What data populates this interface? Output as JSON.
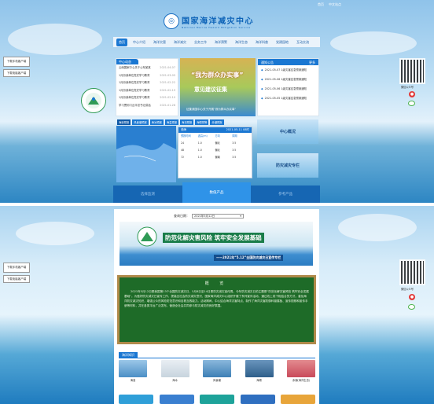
{
  "header": {
    "links": [
      "首页",
      "中文站点"
    ],
    "title": "国家海洋减灾中心",
    "subtitle": "National Marine Hazard Mitigation Service"
  },
  "nav": {
    "items": [
      "首页",
      "中心介绍",
      "海洋灾害",
      "海洋减灾",
      "业务工作",
      "海洋预警",
      "海洋生态",
      "海洋科普",
      "党建园地",
      "互动交流"
    ],
    "active_index": 0
  },
  "float": {
    "btn1": "下载手机客户端",
    "btn2": "下载电脑客户端"
  },
  "qr": {
    "caption": "微信公众号"
  },
  "news": {
    "header": "中心动态",
    "items": [
      {
        "text": "云南国家中心关于公布某某",
        "date": "2021-04-07"
      },
      {
        "text": "1月份我单位党史学习教育",
        "date": "2021-03-05"
      },
      {
        "text": "1月份我单位党史学习教育",
        "date": "2021-02-22"
      },
      {
        "text": "1月份我单位党史学习教育",
        "date": "2021-02-19"
      },
      {
        "text": "1月份我单位党史学习教育",
        "date": "2021-02-10"
      },
      {
        "text": "学习贯彻习近平总书记讲话",
        "date": "2021-01-28"
      }
    ]
  },
  "banner": {
    "title": "“我为群众办实事”",
    "subtitle": "意见建议征集",
    "caption": "征集我国中心关于开展“我为群众办实事”"
  },
  "notice": {
    "header": "通知公告",
    "more": "更多",
    "items": [
      {
        "text": "2021-05-07 1级灾害应急预案通知"
      },
      {
        "text": "2021-05-06 1级灾害应急预案通知"
      },
      {
        "text": "2021-05-06 1级灾害应急预案通知"
      },
      {
        "text": "2021-05-05 1级灾害应急预案通知"
      }
    ]
  },
  "ocean_tabs": [
    "海浪预报",
    "风暴潮预报",
    "海冰预报",
    "海温预报",
    "海流预报",
    "海啸预警",
    "赤潮预报",
    "海洋气象"
  ],
  "ocean": {
    "title": "渤海",
    "time": "2021-05-11 08时",
    "cols": [
      "预报时间",
      "波高(m)",
      "方向",
      "周期"
    ],
    "rows": [
      [
        "24",
        "1.0",
        "偏北",
        "3.5"
      ],
      [
        "48",
        "1.0",
        "偏北",
        "3.5"
      ],
      [
        "72",
        "1.0",
        "偏南",
        "3.5"
      ]
    ]
  },
  "side_cards": [
    "中心概况",
    "防灾减灾专栏"
  ],
  "bottom_tabs": [
    "选择监测",
    "数值产品",
    "参考产品"
  ],
  "bottom_active": 1,
  "page2": {
    "date_label": "查询日期：",
    "date_value": "2021年5月12日",
    "campaign_title": "防范化解灾害风险 筑牢安全发展基础",
    "campaign_sub": "——2021年“5.12”全国防灾减灾日宣传专栏",
    "board_title": "概 览",
    "board_text": "2021年5月12日是我国第13个全国防灾减灾日，5月8日至14日是防灾减灾宣传周。今年防灾减灾日的主题是“防范化解灾害风险 筑牢安全发展基础”。为做好防灾减灾日宣传工作，提高全社会防灾减灾意识，国家海洋减灾中心组织开展了系列宣传活动，通过线上线下相结合的方式，普及海洋防灾减灾知识，增强公众的风险防范意识和自救互救能力。活动期间，中心结合海洋灾害特点，制作了海洋灾害防御科普展板、宣传视频和宣传手册等材料，并在各类平台广泛发布，营造全社会共同参与防灾减灾的良好氛围。",
    "section": "海洋知识",
    "thumbs": [
      "海浪",
      "海冰",
      "风暴潮",
      "海啸",
      "赤潮(海洋生态)"
    ],
    "thumb_colors": [
      "#4b8fc6",
      "#c7d4de",
      "#3d7fb5",
      "#2e5f8a",
      "#c94a5a"
    ],
    "tile_colors": [
      "#2f9fd8",
      "#3a7fd0",
      "#1ea39a",
      "#2f6fc0",
      "#e8a53a"
    ]
  }
}
